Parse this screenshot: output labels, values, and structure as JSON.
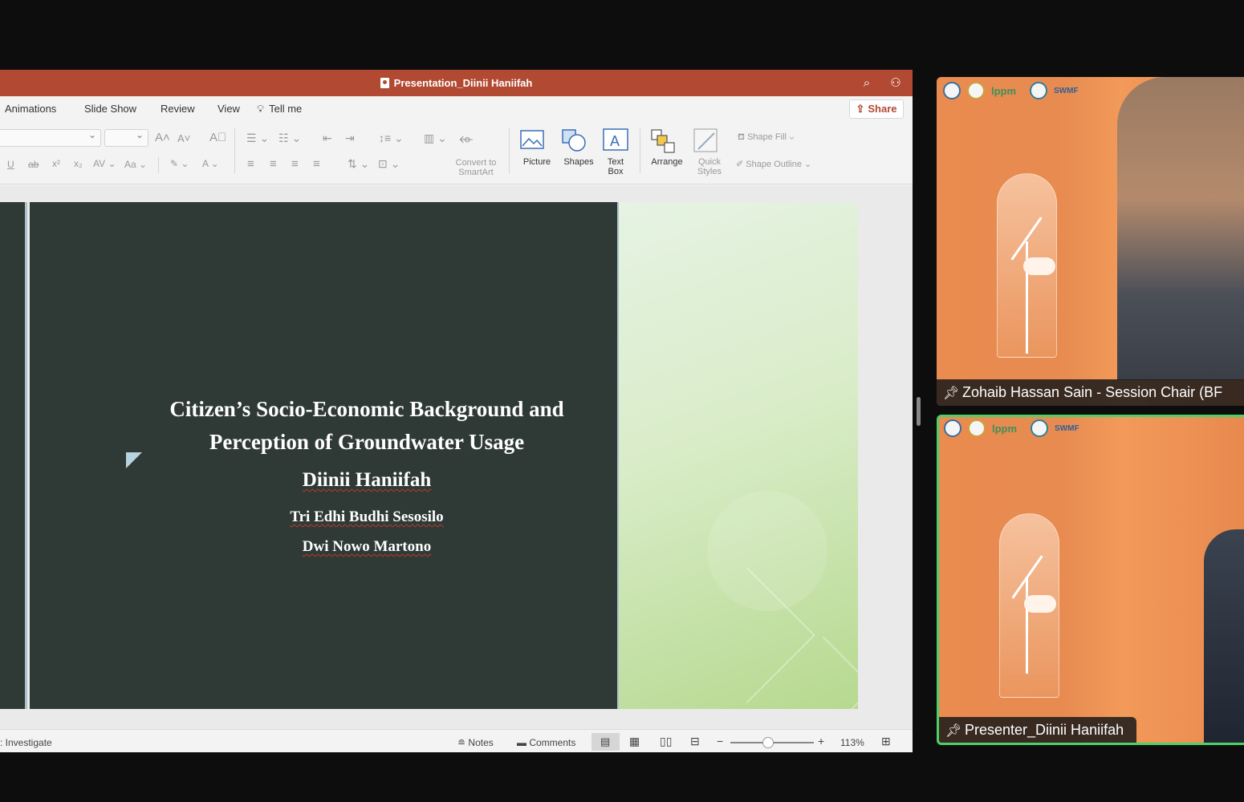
{
  "window": {
    "title": "Presentation_Diinii Haniifah"
  },
  "tabs": [
    "Animations",
    "Slide Show",
    "Review",
    "View",
    "Tell me"
  ],
  "share_label": "Share",
  "ribbon": {
    "convert_label": "Convert to\nSmartArt",
    "picture_label": "Picture",
    "shapes_label": "Shapes",
    "textbox_label": "Text\nBox",
    "arrange_label": "Arrange",
    "quick_styles_label": "Quick\nStyles",
    "shape_fill_label": "Shape Fill",
    "shape_outline_label": "Shape Outline"
  },
  "slide": {
    "title": "Citizen’s Socio-Economic Background and Perception of Groundwater Usage",
    "author": "Diinii Haniifah",
    "coauthor1": "Tri Edhi Budhi Sesosilo",
    "coauthor2": "Dwi Nowo Martono"
  },
  "status": {
    "left_text": ": Investigate",
    "notes_label": "Notes",
    "comments_label": "Comments",
    "zoom_level": "113%",
    "zoom_fraction": 0.45
  },
  "participants": [
    {
      "name": "Zohaib Hassan Sain - Session Chair (BF",
      "active_speaker": false
    },
    {
      "name": "Presenter_Diinii Haniifah",
      "active_speaker": true
    }
  ],
  "tile_logos": {
    "word1": "lppm",
    "word2": "SWMF"
  },
  "colors": {
    "ppt_accent": "#b24a33",
    "slide_bg": "#2f3a37",
    "active_border": "#4cd06a",
    "tile_bg": "#e3824a"
  }
}
